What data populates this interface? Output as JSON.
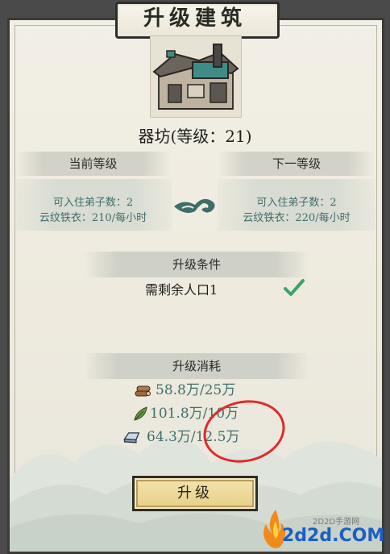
{
  "dialog": {
    "title": "升级建筑",
    "building_name": "器坊(等级：21)"
  },
  "current_level": {
    "header": "当前等级",
    "line1": "可入住弟子数：2",
    "line2": "云纹铁衣：210/每小时"
  },
  "next_level": {
    "header": "下一等级",
    "line1": "可入住弟子数：2",
    "line2": "云纹铁衣：220/每小时"
  },
  "conditions": {
    "header": "升级条件",
    "item": "需剩余人口1",
    "icon": "check-icon",
    "status_color": "#3ba36a"
  },
  "costs": {
    "header": "升级消耗",
    "items": [
      {
        "icon": "wood-logs-icon",
        "text": "58.8万/25万"
      },
      {
        "icon": "leaf-icon",
        "text": "101.8万/10万"
      },
      {
        "icon": "iron-ingot-icon",
        "text": "64.3万/12.5万"
      }
    ]
  },
  "upgrade_button": {
    "label": "升级"
  },
  "watermark": {
    "small": "2D2D手游网",
    "big": "2d2d.COM"
  },
  "colors": {
    "accent_text": "#3e7069",
    "button": "#e9d48f",
    "annotation_circle": "#e02a2a"
  }
}
